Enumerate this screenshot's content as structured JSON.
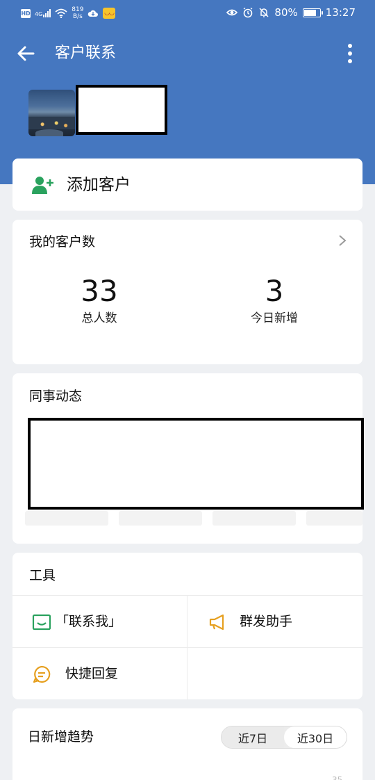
{
  "status_bar": {
    "hd": "HD",
    "signal_type": "4G",
    "net_speed_value": "819",
    "net_speed_unit": "B/s",
    "battery_percent": "80%",
    "battery_level": 0.8,
    "time": "13:27"
  },
  "header": {
    "title": "客户联系"
  },
  "add_customer": {
    "label": "添加客户"
  },
  "customer_count": {
    "title": "我的客户数",
    "total_value": "33",
    "total_label": "总人数",
    "today_value": "3",
    "today_label": "今日新增"
  },
  "colleague_activity": {
    "title": "同事动态"
  },
  "tools": {
    "title": "工具",
    "items": [
      {
        "label": "「联系我」",
        "icon": "contact-me-icon"
      },
      {
        "label": "群发助手",
        "icon": "megaphone-icon"
      },
      {
        "label": "快捷回复",
        "icon": "quick-reply-icon"
      }
    ]
  },
  "trend": {
    "title": "日新增趋势",
    "range_7": "近7日",
    "range_30": "近30日",
    "selected_range": "近30日",
    "axis_top_tick": "35"
  },
  "colors": {
    "header_blue": "#4577c0",
    "icon_green": "#2aa25e",
    "icon_orange": "#e6a020"
  }
}
